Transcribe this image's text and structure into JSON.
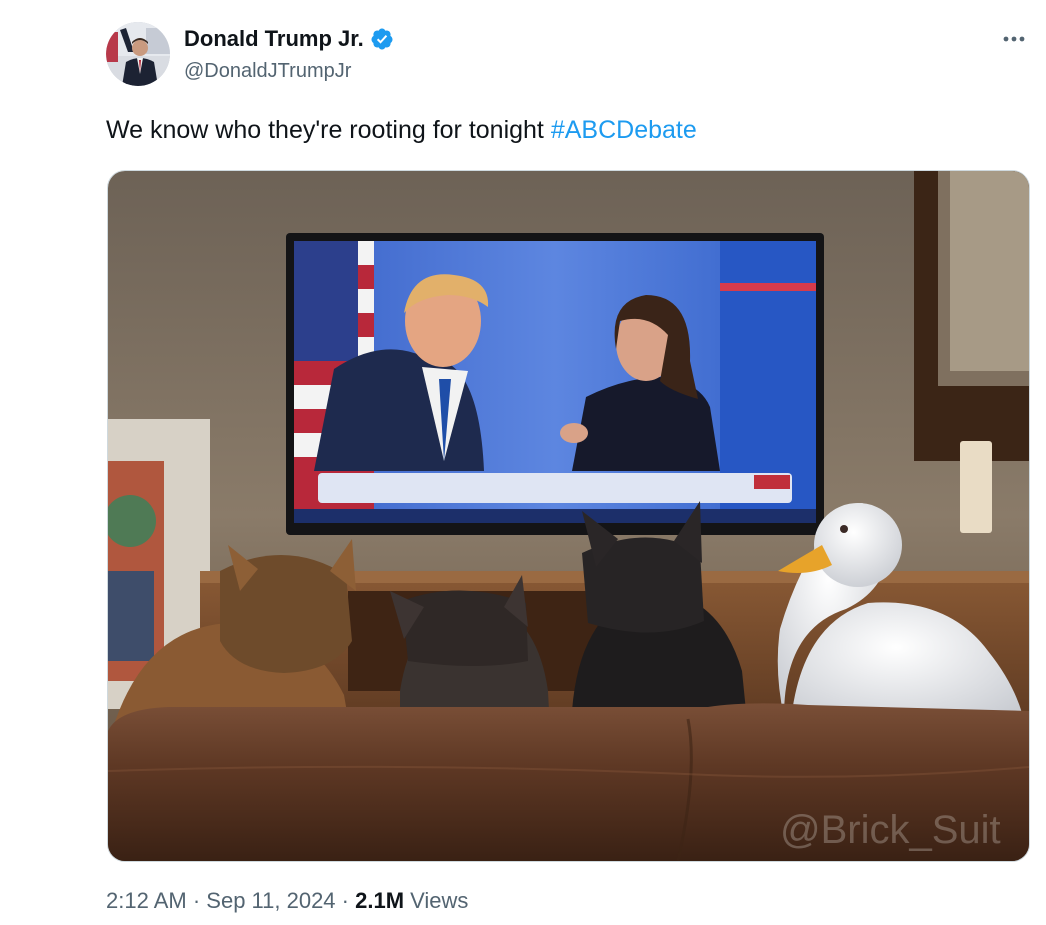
{
  "author": {
    "display_name": "Donald Trump Jr.",
    "handle": "@DonaldJTrumpJr",
    "verified": true
  },
  "tweet": {
    "text": "We know who they're rooting for tonight ",
    "hashtag": "#ABCDebate"
  },
  "media": {
    "watermark": "@Brick_Suit"
  },
  "meta": {
    "time": "2:12 AM",
    "separator": " · ",
    "date": "Sep 11, 2024",
    "separator2": " · ",
    "views_count": "2.1M",
    "views_label": " Views"
  },
  "icons": {
    "verified": "verified-badge-icon",
    "more": "more-options-icon"
  },
  "colors": {
    "link": "#1d9bf0",
    "secondary_text": "#536471",
    "primary_text": "#0f1419"
  }
}
